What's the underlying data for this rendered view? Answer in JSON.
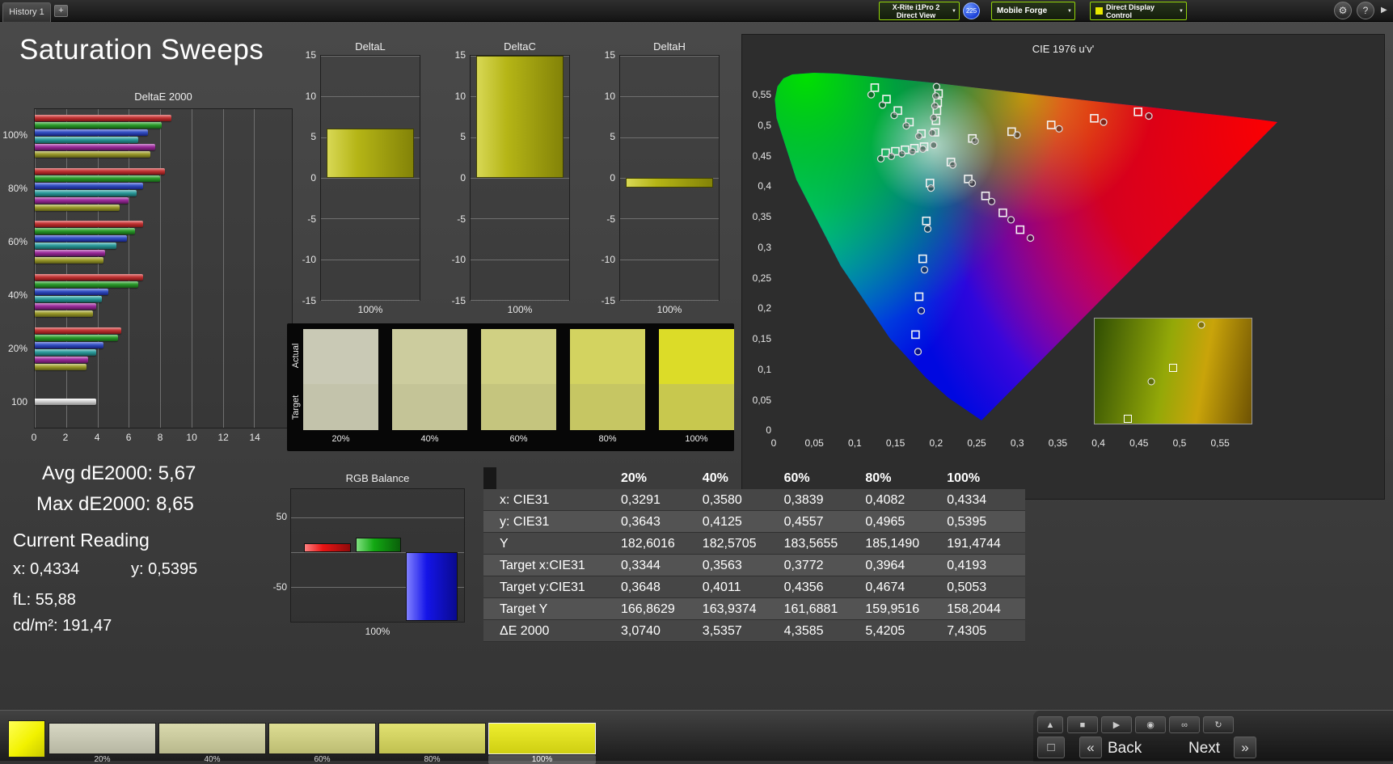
{
  "titlebar": {
    "tab": "History 1",
    "meter_line1": "X-Rite i1Pro 2",
    "meter_line2": "Direct View",
    "badge": "225",
    "source": "Mobile Forge",
    "display_control": "Direct Display Control"
  },
  "icons": {
    "plus": "+",
    "caret": "▼",
    "gear": "⚙",
    "help": "?",
    "collapse": "▶",
    "up": "▲",
    "stop": "■",
    "play": "▶",
    "camera": "◉",
    "infinity": "∞",
    "refresh": "↻",
    "frame": "□",
    "prev": "«",
    "next": "»"
  },
  "page_title": "Saturation Sweeps",
  "deltae2000": {
    "title": "DeltaE 2000",
    "x_ticks": [
      "0",
      "2",
      "4",
      "6",
      "8",
      "10",
      "12",
      "14"
    ],
    "x_max": 16.4,
    "series_colors": [
      "#c23333",
      "#2b9b2b",
      "#3350c3",
      "#2b9b9b",
      "#9b2b9b",
      "#9b9b2b"
    ],
    "groups": [
      {
        "label": "100%",
        "values": [
          8.7,
          8.1,
          7.2,
          6.6,
          7.7,
          7.4
        ]
      },
      {
        "label": "80%",
        "values": [
          8.3,
          8.0,
          6.9,
          6.5,
          6.0,
          5.4
        ]
      },
      {
        "label": "60%",
        "values": [
          6.9,
          6.4,
          5.9,
          5.2,
          4.5,
          4.4
        ]
      },
      {
        "label": "40%",
        "values": [
          6.9,
          6.6,
          4.7,
          4.3,
          3.9,
          3.7
        ]
      },
      {
        "label": "20%",
        "values": [
          5.5,
          5.3,
          4.4,
          3.9,
          3.4,
          3.3
        ]
      },
      {
        "label": "100",
        "values": [
          3.9
        ],
        "white": true
      }
    ]
  },
  "delta_axis_ticks": [
    "15",
    "10",
    "5",
    "0",
    "-5",
    "-10",
    "-15"
  ],
  "delta_axis_range": [
    15,
    -15
  ],
  "delta_charts": [
    {
      "title": "DeltaL",
      "value": 6.1,
      "x_label": "100%"
    },
    {
      "title": "DeltaC",
      "value": 15,
      "x_label": "100%"
    },
    {
      "title": "DeltaH",
      "value": -1.2,
      "x_label": "100%"
    }
  ],
  "swatches": {
    "row_labels": [
      "Actual",
      "Target"
    ],
    "columns": [
      "20%",
      "40%",
      "60%",
      "80%",
      "100%"
    ],
    "actual": [
      "#c9c9b5",
      "#cccc9e",
      "#d0d083",
      "#d3d360",
      "#dcdc28"
    ],
    "target": [
      "#c3c3ab",
      "#c4c497",
      "#c5c57e",
      "#c6c663",
      "#c8c84e"
    ]
  },
  "cie": {
    "title": "CIE 1976 u'v'",
    "y_ticks": [
      "0,55",
      "0,5",
      "0,45",
      "0,4",
      "0,35",
      "0,3",
      "0,25",
      "0,2",
      "0,15",
      "0,1",
      "0,05",
      "0"
    ],
    "x_ticks": [
      "0",
      "0,05",
      "0,1",
      "0,15",
      "0,2",
      "0,25",
      "0,3",
      "0,35",
      "0,4",
      "0,45",
      "0,5",
      "0,55"
    ],
    "targets": [
      [
        0.1994,
        0.4894
      ],
      [
        0.2007,
        0.5084
      ],
      [
        0.2019,
        0.5246
      ],
      [
        0.2029,
        0.5382
      ],
      [
        0.2039,
        0.5529
      ],
      [
        0.2457,
        0.4793
      ],
      [
        0.2943,
        0.4904
      ],
      [
        0.3432,
        0.5014
      ],
      [
        0.3965,
        0.5123
      ],
      [
        0.4507,
        0.5229
      ],
      [
        0.1827,
        0.4872
      ],
      [
        0.1679,
        0.5061
      ],
      [
        0.1536,
        0.5249
      ],
      [
        0.1395,
        0.5437
      ],
      [
        0.125,
        0.5625
      ],
      [
        0.1933,
        0.4062
      ],
      [
        0.1888,
        0.3442
      ],
      [
        0.1843,
        0.2821
      ],
      [
        0.1799,
        0.22
      ],
      [
        0.1754,
        0.1579
      ],
      [
        0.186,
        0.4658
      ],
      [
        0.174,
        0.4633
      ],
      [
        0.1625,
        0.4608
      ],
      [
        0.1505,
        0.4583
      ],
      [
        0.1385,
        0.4557
      ],
      [
        0.2192,
        0.4406
      ],
      [
        0.2406,
        0.4129
      ],
      [
        0.262,
        0.3852
      ],
      [
        0.2834,
        0.3575
      ],
      [
        0.3048,
        0.3298
      ]
    ],
    "measurements": [
      [
        0.1961,
        0.4884
      ],
      [
        0.198,
        0.5132
      ],
      [
        0.1994,
        0.5326
      ],
      [
        0.2006,
        0.5488
      ],
      [
        0.2014,
        0.5641
      ],
      [
        0.249,
        0.475
      ],
      [
        0.301,
        0.485
      ],
      [
        0.353,
        0.495
      ],
      [
        0.408,
        0.506
      ],
      [
        0.464,
        0.516
      ],
      [
        0.1795,
        0.483
      ],
      [
        0.164,
        0.5
      ],
      [
        0.149,
        0.517
      ],
      [
        0.1345,
        0.534
      ],
      [
        0.1205,
        0.551
      ],
      [
        0.1945,
        0.398
      ],
      [
        0.1905,
        0.331
      ],
      [
        0.1865,
        0.264
      ],
      [
        0.1825,
        0.197
      ],
      [
        0.1785,
        0.13
      ],
      [
        0.1845,
        0.462
      ],
      [
        0.1715,
        0.458
      ],
      [
        0.1585,
        0.454
      ],
      [
        0.1455,
        0.45
      ],
      [
        0.1325,
        0.446
      ],
      [
        0.2215,
        0.436
      ],
      [
        0.2455,
        0.406
      ],
      [
        0.2695,
        0.376
      ],
      [
        0.2935,
        0.346
      ],
      [
        0.3175,
        0.316
      ],
      [
        0.1978,
        0.4683
      ]
    ],
    "inset": {
      "squares": [
        [
          0.5,
          0.47
        ],
        [
          0.21,
          0.95
        ]
      ],
      "circles": [
        [
          0.68,
          0.06
        ],
        [
          0.36,
          0.6
        ]
      ]
    }
  },
  "readings": {
    "avg": "Avg dE2000: 5,67",
    "max": "Max dE2000: 8,65",
    "current_title": "Current Reading",
    "x": "x: 0,4334",
    "y": "y: 0,5395",
    "fl": "fL: 55,88",
    "cd": "cd/m²: 191,47"
  },
  "rgb_balance": {
    "title": "RGB Balance",
    "x_label": "100%",
    "y_ticks": [
      {
        "label": "50",
        "value": 50
      },
      {
        "label": "-50",
        "value": -50
      }
    ],
    "grid_values": [
      50,
      0,
      -50
    ],
    "range": [
      90,
      -100
    ],
    "values": [
      12,
      21,
      -99
    ]
  },
  "table": {
    "columns": [
      "20%",
      "40%",
      "60%",
      "80%",
      "100%"
    ],
    "rows": [
      {
        "label": "x: CIE31",
        "values": [
          "0,3291",
          "0,3580",
          "0,3839",
          "0,4082",
          "0,4334"
        ]
      },
      {
        "label": "y: CIE31",
        "values": [
          "0,3643",
          "0,4125",
          "0,4557",
          "0,4965",
          "0,5395"
        ]
      },
      {
        "label": "Y",
        "values": [
          "182,6016",
          "182,5705",
          "183,5655",
          "185,1490",
          "191,4744"
        ]
      },
      {
        "label": "Target x:CIE31",
        "values": [
          "0,3344",
          "0,3563",
          "0,3772",
          "0,3964",
          "0,4193"
        ]
      },
      {
        "label": "Target y:CIE31",
        "values": [
          "0,3648",
          "0,4011",
          "0,4356",
          "0,4674",
          "0,5053"
        ]
      },
      {
        "label": "Target Y",
        "values": [
          "166,8629",
          "163,9374",
          "161,6881",
          "159,9516",
          "158,2044"
        ]
      },
      {
        "label": "ΔE 2000",
        "values": [
          "3,0740",
          "3,5357",
          "4,3585",
          "5,4205",
          "7,4305"
        ]
      }
    ]
  },
  "bottom": {
    "swatch_labels": [
      "20%",
      "40%",
      "60%",
      "80%",
      "100%"
    ],
    "swatch_colors_top": [
      "#d8d8c4",
      "#dadaae",
      "#dede94",
      "#e2e272",
      "#eeee2e"
    ],
    "swatch_colors_bottom": [
      "#b6b6a2",
      "#b8b88c",
      "#bcbc72",
      "#c0c050",
      "#cfcf12"
    ],
    "selected_index": 4,
    "current_color": "#f2f200",
    "back": "Back",
    "next": "Next"
  }
}
